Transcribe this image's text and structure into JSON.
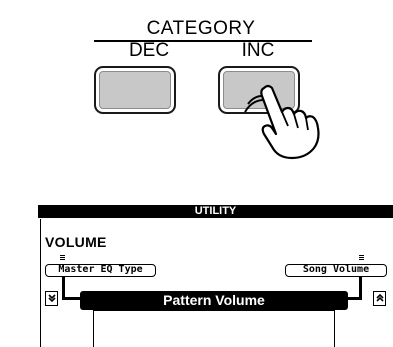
{
  "category": {
    "title": "CATEGORY",
    "dec_label": "DEC",
    "inc_label": "INC",
    "pressed": "INC"
  },
  "lcd": {
    "header": "UTILITY",
    "section": "VOLUME",
    "left_param": "Master EQ Type",
    "right_param": "Song Volume",
    "current_param": "Pattern Volume",
    "scroll_down_icon": "double-down-arrow-icon",
    "scroll_up_icon": "double-up-arrow-icon"
  },
  "icons": {
    "hand": "pointing-hand-icon"
  }
}
